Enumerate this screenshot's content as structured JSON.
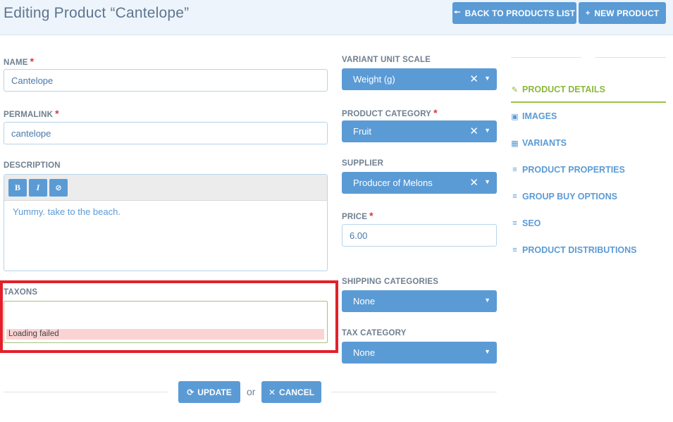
{
  "header": {
    "title": "Editing Product “Cantelope”",
    "back_button": "BACK TO PRODUCTS LIST",
    "new_button": "NEW PRODUCT"
  },
  "form": {
    "name": {
      "label": "NAME",
      "required": "*",
      "value": "Cantelope"
    },
    "permalink": {
      "label": "PERMALINK",
      "required": "*",
      "value": "cantelope"
    },
    "description": {
      "label": "DESCRIPTION",
      "toolbar": {
        "bold": "B",
        "italic": "I",
        "clear": "⊘"
      },
      "value": "Yummy. take to the beach."
    },
    "taxons": {
      "label": "TAXONS",
      "error": "Loading failed"
    },
    "variant_unit_scale": {
      "label": "VARIANT UNIT SCALE",
      "value": "Weight (g)"
    },
    "product_category": {
      "label": "PRODUCT CATEGORY",
      "required": "*",
      "value": "Fruit"
    },
    "supplier": {
      "label": "SUPPLIER",
      "value": "Producer of Melons"
    },
    "price": {
      "label": "PRICE",
      "required": "*",
      "value": "6.00"
    },
    "shipping_categories": {
      "label": "SHIPPING CATEGORIES",
      "value": "None"
    },
    "tax_category": {
      "label": "TAX CATEGORY",
      "value": "None"
    }
  },
  "actions": {
    "update": "UPDATE",
    "or": "or",
    "cancel": "CANCEL"
  },
  "sidebar": {
    "items": [
      {
        "label": "PRODUCT DETAILS",
        "icon": "edit-icon",
        "active": true
      },
      {
        "label": "IMAGES",
        "icon": "image-icon"
      },
      {
        "label": "VARIANTS",
        "icon": "grid-icon"
      },
      {
        "label": "PRODUCT PROPERTIES",
        "icon": "list-icon"
      },
      {
        "label": "GROUP BUY OPTIONS",
        "icon": "list-icon"
      },
      {
        "label": "SEO",
        "icon": "list-icon"
      },
      {
        "label": "PRODUCT DISTRIBUTIONS",
        "icon": "list-icon"
      }
    ]
  },
  "colors": {
    "accent": "#5b9bd5",
    "active": "#8ab83c",
    "error_bg": "#fbd3d3",
    "highlight": "#e3202a"
  }
}
